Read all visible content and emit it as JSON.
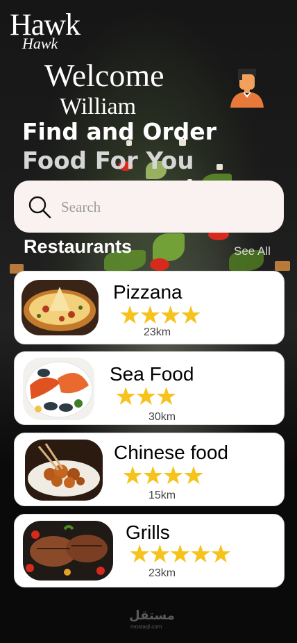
{
  "brand": {
    "logo": "Hawk",
    "logo_script": "Hawk"
  },
  "greeting": {
    "welcome": "Welcome",
    "user_name": "William"
  },
  "headline": {
    "line1": "Find and Order",
    "line2": "Food For You"
  },
  "search": {
    "placeholder": "Search"
  },
  "restaurants_section": {
    "title": "Restaurants",
    "see_all": "See All",
    "ghost_distance": "23km"
  },
  "restaurants": [
    {
      "name": "Pizzana",
      "rating": 4,
      "stars": "★★★★",
      "distance": "23km"
    },
    {
      "name": "Sea Food",
      "rating": 3,
      "stars": "★★★",
      "distance": "30km"
    },
    {
      "name": "Chinese food",
      "rating": 4,
      "stars": "★★★★",
      "distance": "15km"
    },
    {
      "name": "Grills",
      "rating": 5,
      "stars": "★★★★★",
      "distance": "23km"
    }
  ],
  "watermark": {
    "arabic": "مستقل",
    "latin": "mostaql.com"
  },
  "colors": {
    "star": "#f6c21c",
    "card": "#ffffff",
    "search_bg": "#faf2f0",
    "background": "#0b0a0a"
  }
}
